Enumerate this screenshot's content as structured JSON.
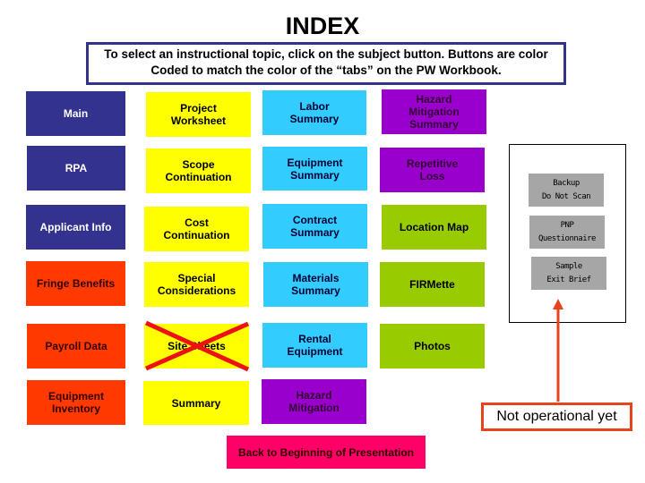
{
  "page": {
    "title": "INDEX",
    "instructions": [
      "To select an instructional topic, click on the subject button.  Buttons are color",
      "Coded to match the color of the “tabs” on the PW Workbook."
    ]
  },
  "colors": {
    "navy": "#33338f",
    "yellow": "#ffff00",
    "cyan": "#33ccff",
    "purple": "#9900cc",
    "green": "#99cc00",
    "orange": "#ff3a00",
    "pink": "#ff0066",
    "gray": "#a6a6a6",
    "annotation_red": "#e8441c"
  },
  "buttons": {
    "main": "Main",
    "rpa": "RPA",
    "applicant_info": "Applicant Info",
    "fringe_benefits": "Fringe Benefits",
    "payroll_data": "Payroll Data",
    "equipment_inventory": "Equipment\nInventory",
    "project_worksheet": "Project\nWorksheet",
    "scope_continuation": "Scope\nContinuation",
    "cost_continuation": "Cost\nContinuation",
    "special_considerations": "Special\nConsiderations",
    "site_sheets": "Site Sheets",
    "summary": "Summary",
    "labor_summary": "Labor\nSummary",
    "equipment_summary": "Equipment\nSummary",
    "contract_summary": "Contract\nSummary",
    "materials_summary": "Materials\nSummary",
    "rental_equipment": "Rental\nEquipment",
    "hazard_mitigation": "Hazard\nMitigation",
    "hazard_mitigation_summary": "Hazard\nMitigation\nSummary",
    "repetitive_loss": "Repetitive\nLoss",
    "location_map": "Location Map",
    "firmette": "FIRMette",
    "photos": "Photos",
    "back_to_beginning": "Back  to Beginning of Presentation"
  },
  "not_operational_panel": {
    "backup": [
      "Backup",
      "Do Not Scan"
    ],
    "pnp": [
      "PNP",
      "Questionnaire"
    ],
    "sample": [
      "Sample",
      "Exit Brief"
    ]
  },
  "annotation": {
    "label": "Not operational yet"
  },
  "site_sheets_crossed_out": true
}
